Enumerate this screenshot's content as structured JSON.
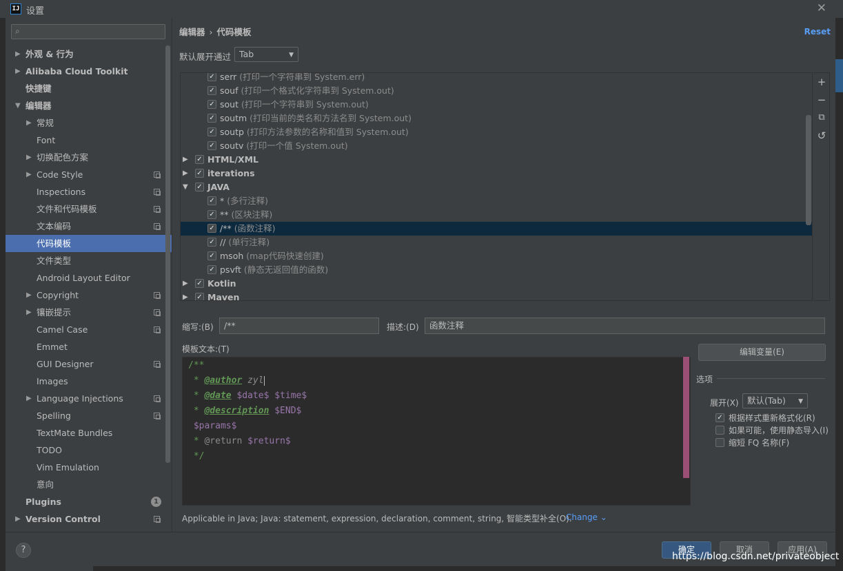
{
  "window": {
    "title": "设置",
    "app_icon": "IJ"
  },
  "search": {
    "placeholder": ""
  },
  "sidebar": {
    "items": [
      {
        "label": "外观 & 行为",
        "level": 0,
        "bold": true,
        "arrow": "right",
        "icon": false
      },
      {
        "label": "Alibaba Cloud Toolkit",
        "level": 0,
        "bold": true,
        "arrow": "right",
        "icon": false
      },
      {
        "label": "快捷键",
        "level": 0,
        "bold": true,
        "arrow": "",
        "icon": false
      },
      {
        "label": "编辑器",
        "level": 0,
        "bold": true,
        "arrow": "down",
        "icon": false
      },
      {
        "label": "常规",
        "level": 1,
        "bold": false,
        "arrow": "right",
        "icon": false
      },
      {
        "label": "Font",
        "level": 1,
        "bold": false,
        "arrow": "",
        "icon": false
      },
      {
        "label": "切换配色方案",
        "level": 1,
        "bold": false,
        "arrow": "right",
        "icon": false
      },
      {
        "label": "Code Style",
        "level": 1,
        "bold": false,
        "arrow": "right",
        "icon": true
      },
      {
        "label": "Inspections",
        "level": 1,
        "bold": false,
        "arrow": "",
        "icon": true
      },
      {
        "label": "文件和代码模板",
        "level": 1,
        "bold": false,
        "arrow": "",
        "icon": true
      },
      {
        "label": "文本编码",
        "level": 1,
        "bold": false,
        "arrow": "",
        "icon": true
      },
      {
        "label": "代码模板",
        "level": 1,
        "bold": false,
        "arrow": "",
        "icon": false,
        "selected": true
      },
      {
        "label": "文件类型",
        "level": 1,
        "bold": false,
        "arrow": "",
        "icon": false
      },
      {
        "label": "Android Layout Editor",
        "level": 1,
        "bold": false,
        "arrow": "",
        "icon": false
      },
      {
        "label": "Copyright",
        "level": 1,
        "bold": false,
        "arrow": "right",
        "icon": true
      },
      {
        "label": "镶嵌提示",
        "level": 1,
        "bold": false,
        "arrow": "right",
        "icon": true
      },
      {
        "label": "Camel Case",
        "level": 1,
        "bold": false,
        "arrow": "",
        "icon": true
      },
      {
        "label": "Emmet",
        "level": 1,
        "bold": false,
        "arrow": "",
        "icon": false
      },
      {
        "label": "GUI Designer",
        "level": 1,
        "bold": false,
        "arrow": "",
        "icon": true
      },
      {
        "label": "Images",
        "level": 1,
        "bold": false,
        "arrow": "",
        "icon": false
      },
      {
        "label": "Language Injections",
        "level": 1,
        "bold": false,
        "arrow": "right",
        "icon": true
      },
      {
        "label": "Spelling",
        "level": 1,
        "bold": false,
        "arrow": "",
        "icon": true
      },
      {
        "label": "TextMate Bundles",
        "level": 1,
        "bold": false,
        "arrow": "",
        "icon": false
      },
      {
        "label": "TODO",
        "level": 1,
        "bold": false,
        "arrow": "",
        "icon": false
      },
      {
        "label": "Vim Emulation",
        "level": 1,
        "bold": false,
        "arrow": "",
        "icon": false
      },
      {
        "label": "意向",
        "level": 1,
        "bold": false,
        "arrow": "",
        "icon": false
      },
      {
        "label": "Plugins",
        "level": 0,
        "bold": true,
        "arrow": "",
        "icon": false,
        "badge": "1"
      },
      {
        "label": "Version Control",
        "level": 0,
        "bold": true,
        "arrow": "right",
        "icon": true
      }
    ]
  },
  "breadcrumb": {
    "parent": "编辑器",
    "separator": "›",
    "current": "代码模板"
  },
  "reset_label": "Reset",
  "expand_with": {
    "label": "默认展开通过",
    "value": "Tab"
  },
  "templates": [
    {
      "type": "item",
      "name": "serr",
      "desc": "(打印一个字符串到 System.err)",
      "checked": true
    },
    {
      "type": "item",
      "name": "souf",
      "desc": "(打印一个格式化字符串到 System.out)",
      "checked": true
    },
    {
      "type": "item",
      "name": "sout",
      "desc": "(打印一个字符串到 System.out)",
      "checked": true
    },
    {
      "type": "item",
      "name": "soutm",
      "desc": "(打印当前的类名和方法名到 System.out)",
      "checked": true
    },
    {
      "type": "item",
      "name": "soutp",
      "desc": "(打印方法参数的名称和值到 System.out)",
      "checked": true
    },
    {
      "type": "item",
      "name": "soutv",
      "desc": "(打印一个值 System.out)",
      "checked": true
    },
    {
      "type": "group",
      "name": "HTML/XML",
      "checked": true,
      "expanded": false
    },
    {
      "type": "group",
      "name": "iterations",
      "checked": true,
      "expanded": false
    },
    {
      "type": "group",
      "name": "JAVA",
      "checked": true,
      "expanded": true
    },
    {
      "type": "item",
      "name": "*",
      "desc": "(多行注释)",
      "checked": true
    },
    {
      "type": "item",
      "name": "**",
      "desc": "(区块注释)",
      "checked": true
    },
    {
      "type": "item",
      "name": "/**",
      "desc": "(函数注释)",
      "checked": true,
      "selected": true
    },
    {
      "type": "item",
      "name": "//",
      "desc": "(单行注释)",
      "checked": true
    },
    {
      "type": "item",
      "name": "msoh",
      "desc": "(map代码快速创建)",
      "checked": true
    },
    {
      "type": "item",
      "name": "psvft",
      "desc": "(静态无返回值的函数)",
      "checked": true
    },
    {
      "type": "group",
      "name": "Kotlin",
      "checked": true,
      "expanded": false
    },
    {
      "type": "group",
      "name": "Maven",
      "checked": true,
      "expanded": false
    }
  ],
  "toolbar": {
    "add": "+",
    "remove": "−",
    "copy": "⧉",
    "restore": "↺"
  },
  "abbreviation": {
    "label": "缩写:(B)",
    "value": "/**"
  },
  "description": {
    "label": "描述:(D)",
    "value": "函数注释"
  },
  "template_text_label": "模板文本:(T)",
  "code": {
    "l1": "/**",
    "l2_star": " * ",
    "l2_tag": "@author",
    "l2_val": " zyl",
    "l3_star": " * ",
    "l3_tag": "@date",
    "l3_v1": " $date$",
    "l3_v2": " $time$",
    "l4_star": " * ",
    "l4_tag": "@description",
    "l4_v": " $END$",
    "l5": " $params$",
    "l6_star": " * ",
    "l6_tag": "@return",
    "l6_v": " $return$",
    "l7": " */"
  },
  "edit_vars_button": "编辑变量(E)",
  "options": {
    "title": "选项",
    "expand_label": "展开(X)",
    "expand_value": "默认(Tab)",
    "reformat": {
      "label": "根据样式重新格式化(R)",
      "checked": true
    },
    "static_import": {
      "label": "如果可能，使用静态导入(I)",
      "checked": false
    },
    "shorten_fq": {
      "label": "缩短 FQ 名称(F)",
      "checked": false
    }
  },
  "context": {
    "text": "Applicable in Java; Java: statement, expression, declaration, comment, string, 智能类型补全(O).",
    "change": "Change ⌄"
  },
  "buttons": {
    "ok": "确定",
    "cancel": "取消",
    "apply": "应用(A)"
  },
  "watermark": "https://blog.csdn.net/privateobject"
}
